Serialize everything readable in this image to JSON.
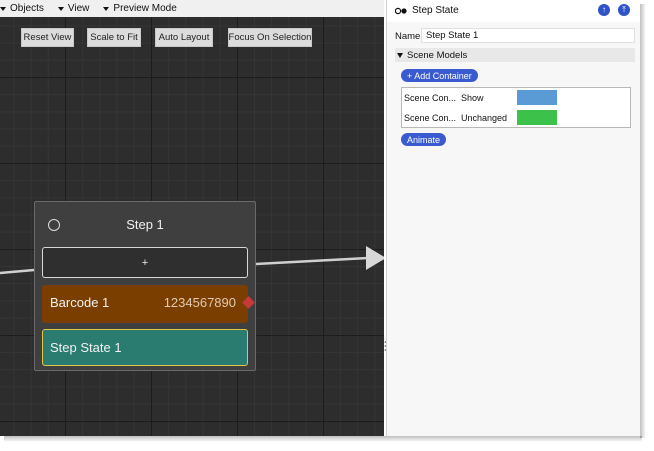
{
  "menu": {
    "objects": "Objects",
    "view": "View",
    "preview": "Preview Mode"
  },
  "toolbar": {
    "reset_view": "Reset View",
    "scale_to_fit": "Scale to Fit",
    "auto_layout": "Auto Layout",
    "focus_on_selection": "Focus On Selection"
  },
  "node": {
    "title": "Step 1",
    "add_label": "+",
    "barcode_label": "Barcode 1",
    "barcode_value": "1234567890",
    "step_state_label": "Step State 1"
  },
  "panel": {
    "title": "Step State",
    "up_icon": "arrow-up-icon",
    "top_icon": "arrow-top-icon",
    "name_label": "Name",
    "name_value": "Step State 1",
    "section_title": "Scene Models",
    "add_container": "+ Add Container",
    "models": [
      {
        "name": "Scene Con...",
        "state": "Show",
        "color": "#5b9bd5"
      },
      {
        "name": "Scene Con...",
        "state": "Unchanged",
        "color": "#3cc24a"
      }
    ],
    "animate": "Animate"
  },
  "colors": {
    "canvas_bg": "#2d2d2d",
    "barcode": "#7a3e00",
    "step_state": "#2a7c70",
    "selection": "#e1c44a",
    "accent": "#3a5bd0"
  }
}
